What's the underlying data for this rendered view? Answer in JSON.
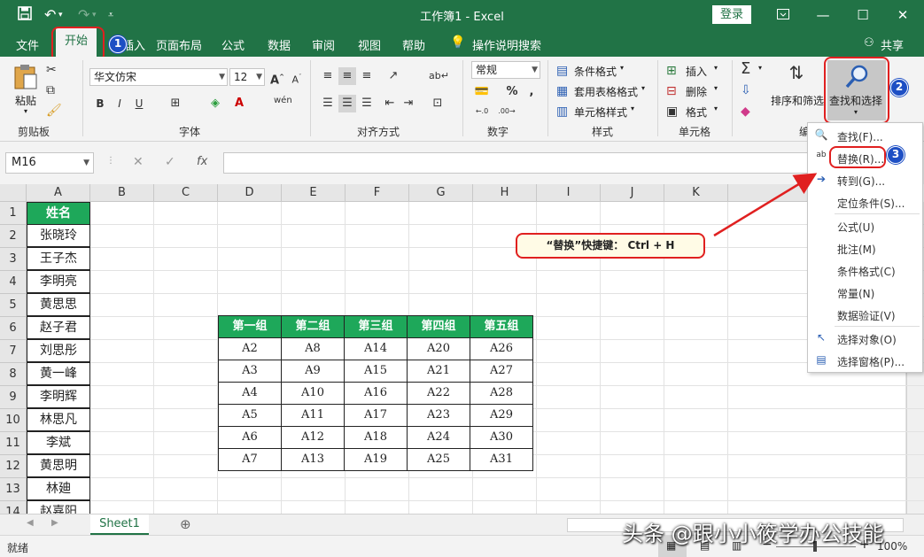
{
  "window": {
    "title": "工作簿1  -  Excel",
    "login": "登录"
  },
  "menu": {
    "tabs": [
      "文件",
      "开始",
      "插入",
      "页面布局",
      "公式",
      "数据",
      "审阅",
      "视图",
      "帮助"
    ],
    "tell_me": "操作说明搜索",
    "share": "共享"
  },
  "ribbon": {
    "clipboard": {
      "paste": "粘贴",
      "label": "剪贴板"
    },
    "font": {
      "name": "华文仿宋",
      "size": "12",
      "label": "字体"
    },
    "alignment": {
      "label": "对齐方式"
    },
    "number": {
      "format": "常规",
      "label": "数字"
    },
    "styles": {
      "conditional": "条件格式",
      "table": "套用表格格式",
      "cell": "单元格样式",
      "label": "样式"
    },
    "cells": {
      "insert": "插入",
      "delete": "删除",
      "format": "格式",
      "label": "单元格"
    },
    "editing": {
      "sort_filter": "排序和筛选",
      "find_select": "查找和选择",
      "label": "编"
    }
  },
  "formula_bar": {
    "name_box": "M16"
  },
  "grid": {
    "columns": [
      "A",
      "B",
      "C",
      "D",
      "E",
      "F",
      "G",
      "H",
      "I",
      "J",
      "K",
      "L"
    ],
    "rows": [
      "1",
      "2",
      "3",
      "4",
      "5",
      "6",
      "7",
      "8",
      "9",
      "10",
      "11",
      "12",
      "13",
      "14"
    ],
    "name_header": "姓名",
    "names": [
      "张晓玲",
      "王子杰",
      "李明亮",
      "黄思思",
      "赵子君",
      "刘思彤",
      "黄一峰",
      "李明辉",
      "林思凡",
      "李斌",
      "黄思明",
      "林廸",
      "赵嘉阳"
    ],
    "table": {
      "headers": [
        "第一组",
        "第二组",
        "第三组",
        "第四组",
        "第五组"
      ],
      "rows": [
        [
          "A2",
          "A8",
          "A14",
          "A20",
          "A26"
        ],
        [
          "A3",
          "A9",
          "A15",
          "A21",
          "A27"
        ],
        [
          "A4",
          "A10",
          "A16",
          "A22",
          "A28"
        ],
        [
          "A5",
          "A11",
          "A17",
          "A23",
          "A29"
        ],
        [
          "A6",
          "A12",
          "A18",
          "A24",
          "A30"
        ],
        [
          "A7",
          "A13",
          "A19",
          "A25",
          "A31"
        ]
      ]
    }
  },
  "dropdown": {
    "items": [
      "查找(F)...",
      "替换(R)...",
      "转到(G)...",
      "定位条件(S)...",
      "公式(U)",
      "批注(M)",
      "条件格式(C)",
      "常量(N)",
      "数据验证(V)",
      "选择对象(O)",
      "选择窗格(P)..."
    ]
  },
  "callout": "“替换”快捷键： Ctrl + H",
  "badges": [
    "1",
    "2",
    "3"
  ],
  "sheet": {
    "tab": "Sheet1"
  },
  "status": {
    "text": "就绪",
    "zoom": "100%"
  },
  "watermark": "头条 @跟小小筱学办公技能",
  "colors": {
    "excel_green": "#217346",
    "header_green": "#1ea85a",
    "highlight_red": "#e02020",
    "badge_blue": "#1d4fc4"
  }
}
